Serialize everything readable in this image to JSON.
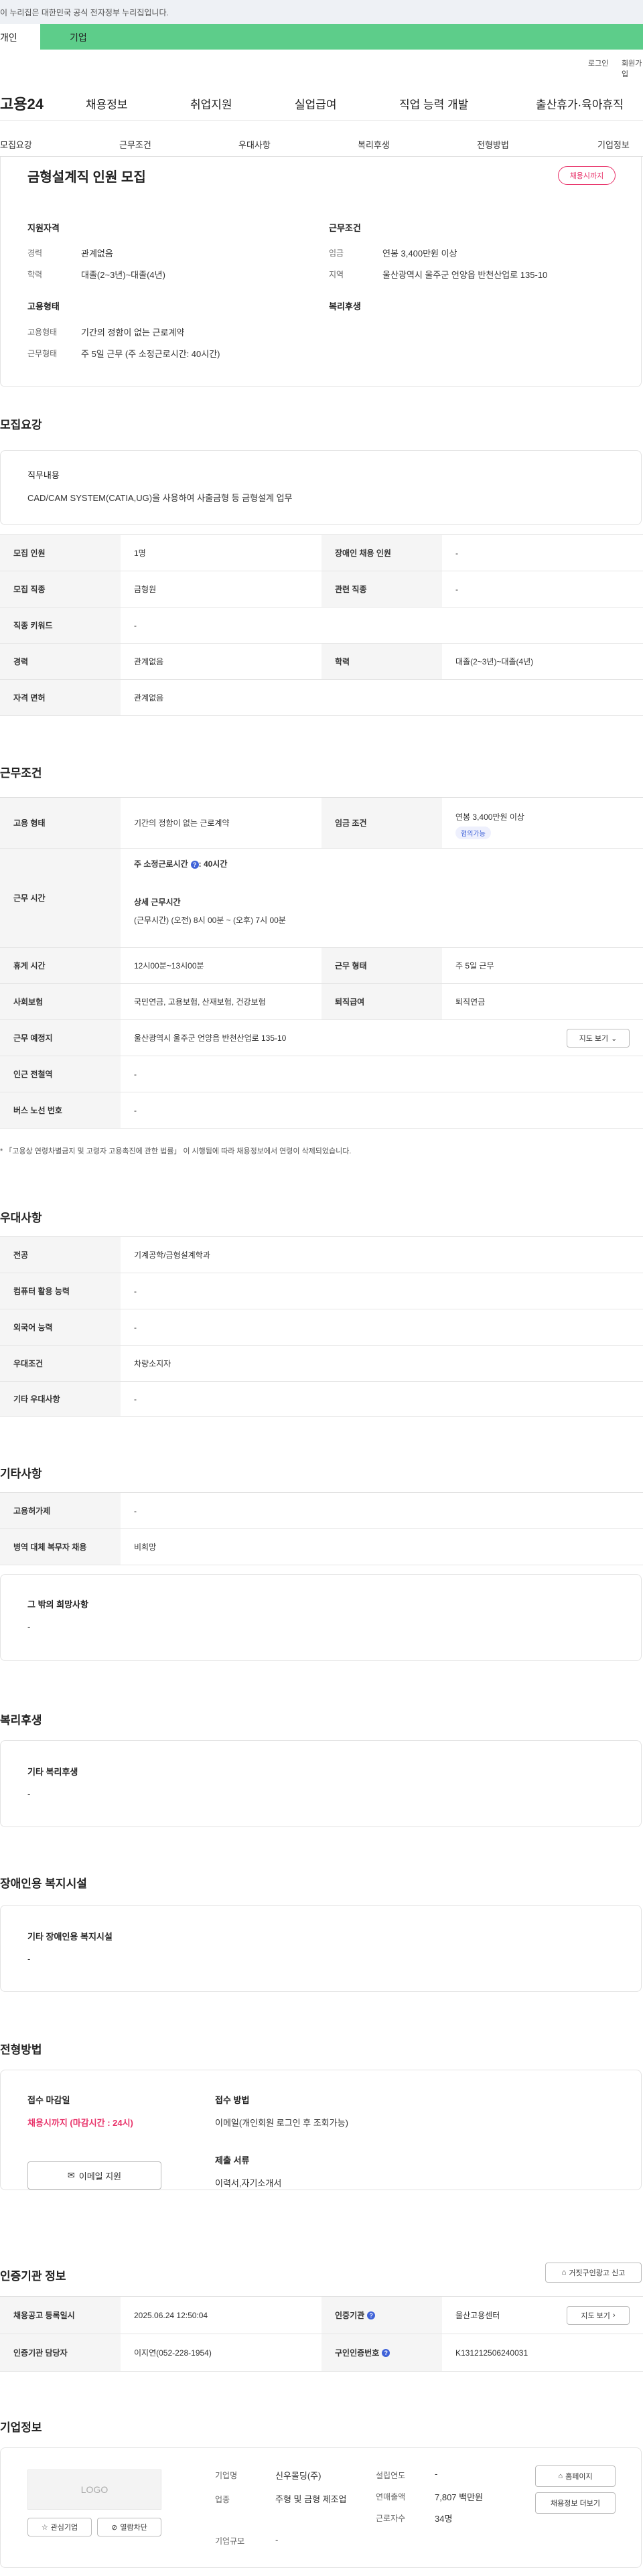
{
  "banner": "이 누리집은 대한민국 공식 전자정부 누리집입니다.",
  "topTabs": [
    "개인",
    "기업"
  ],
  "util": [
    "로그인",
    "회원가입"
  ],
  "gnb": {
    "logo": "고용24",
    "menu": [
      "채용정보",
      "취업지원",
      "실업급여",
      "직업 능력 개발",
      "출산휴가·육아휴직"
    ]
  },
  "subnav": [
    "모집요강",
    "근무조건",
    "우대사항",
    "복리후생",
    "전형방법",
    "기업정보"
  ],
  "summary": {
    "title": "금형설계직 인원 모집",
    "badge": "채용시까지",
    "qual_h": "지원자격",
    "work_h": "근무조건",
    "emp_h": "고용형태",
    "welfare_h": "복리후생",
    "rows": {
      "career_k": "경력",
      "career_v": "관계없음",
      "edu_k": "학력",
      "edu_v": "대졸(2~3년)~대졸(4년)",
      "wage_k": "임금",
      "wage_v": "연봉 3,400만원 이상",
      "region_k": "지역",
      "region_v": "울산광역시 울주군 언양읍 반천산업로 135-10",
      "type_k": "고용형태",
      "type_v": "기간의 정함이 없는 근로계약",
      "form_k": "근무형태",
      "form_v": "주 5일 근무 (주 소정근로시간: 40시간)"
    }
  },
  "recruit": {
    "heading": "모집요강",
    "duty_h": "직무내용",
    "duty_v": "CAD/CAM SYSTEM(CATIA,UG)을 사용하여 사출금형 등 금형설계 업무",
    "table": {
      "r1": [
        "모집 인원",
        "1명",
        "장애인 채용 인원",
        "-"
      ],
      "r2": [
        "모집 직종",
        "금형원",
        "관련 직종",
        "-"
      ],
      "r3": [
        "직종 키워드",
        "-"
      ],
      "r4": [
        "경력",
        "관계없음",
        "학력",
        "대졸(2~3년)~대졸(4년)"
      ],
      "r5": [
        "자격 면허",
        "관계없음"
      ]
    }
  },
  "conditions": {
    "heading": "근무조건",
    "emp_k": "고용 형태",
    "emp_v": "기간의 정함이 없는 근로계약",
    "wage_k": "임금 조건",
    "wage_v": "연봉 3,400만원 이상",
    "wage_tag": "협의가능",
    "hours_k": "근무 시간",
    "hours_1": "주 소정근로시간",
    "hours_1v": ": 40시간",
    "hours_2": "상세 근무시간",
    "hours_3": "(근무시간) (오전) 8시 00분 ~ (오후) 7시 00분",
    "rest_k": "휴게 시간",
    "rest_v": "12시00분~13시00분",
    "shift_k": "근무 형태",
    "shift_v": "주 5일 근무",
    "ins_k": "사회보험",
    "ins_v": "국민연금, 고용보험, 산재보험, 건강보험",
    "ret_k": "퇴직급여",
    "ret_v": "퇴직연금",
    "place_k": "근무 예정지",
    "place_v": "울산광역시 울주군 언양읍 반천산업로 135-10",
    "map_btn": "지도 보기",
    "subway_k": "인근 전철역",
    "subway_v": "-",
    "bus_k": "버스 노선 번호",
    "bus_v": "-",
    "note": "* 「고용상 연령차별금지 및 고령자 고용촉진에 관한 법률」 이 시행됨에 따라 채용정보에서 연령이 삭제되었습니다."
  },
  "preference": {
    "heading": "우대사항",
    "rows": [
      [
        "전공",
        "기계공학/금형설계학과"
      ],
      [
        "컴퓨터 활용 능력",
        "-"
      ],
      [
        "외국어 능력",
        "-"
      ],
      [
        "우대조건",
        "차량소지자"
      ],
      [
        "기타 우대사항",
        "-"
      ]
    ]
  },
  "etc": {
    "heading": "기타사항",
    "rows": [
      [
        "고용허가제",
        "-"
      ],
      [
        "병역 대체 복무자 채용",
        "비희망"
      ]
    ],
    "other_h": "그 밖의 희망사항",
    "other_v": "-"
  },
  "welfare": {
    "heading": "복리후생",
    "h": "기타 복리후생",
    "v": "-"
  },
  "disabled": {
    "heading": "장애인용 복지시설",
    "h": "기타 장애인용 복지시설",
    "v": "-"
  },
  "screening": {
    "heading": "전형방법",
    "deadline_h": "접수 마감일",
    "deadline_v": "채용시까지 (마감시간 : 24시)",
    "email_btn": "이메일 지원",
    "method_h": "접수 방법",
    "method_v": "이메일(개인회원 로그인 후 조회가능)",
    "docs_h": "제출 서류",
    "docs_v": "이력서,자기소개서"
  },
  "auth": {
    "heading": "인증기관 정보",
    "report_btn": "거짓구인광고 신고",
    "reg_k": "채용공고 등록일시",
    "reg_v": "2025.06.24 12:50:04",
    "org_k": "인증기관",
    "org_v": "울산고용센터",
    "map_btn": "지도 보기",
    "mgr_k": "인증기관 담당자",
    "mgr_v": "이지연(052-228-1954)",
    "no_k": "구인인증번호",
    "no_v": "K131212506240031"
  },
  "company": {
    "heading": "기업정보",
    "logo": "LOGO",
    "fav_btn": "관심기업",
    "block_btn": "열람차단",
    "name_k": "기업명",
    "name_v": "신우몰딩(주)",
    "ind_k": "업종",
    "ind_v": "주형 및 금형 제조업",
    "size_k": "기업규모",
    "size_v": "-",
    "est_k": "설립연도",
    "est_v": "-",
    "sales_k": "연매출액",
    "sales_v": "7,807 백만원",
    "emp_k": "근로자수",
    "emp_v": "34명",
    "home_btn": "홈페이지",
    "more_btn": "채용정보 더보기"
  },
  "colors": {
    "accent_green": "#5dcd8a",
    "badge_pink": "#e8336a",
    "info_blue": "#3f62d8"
  }
}
